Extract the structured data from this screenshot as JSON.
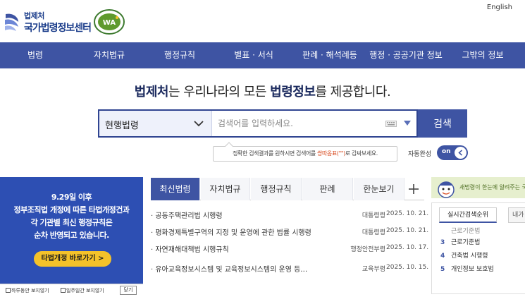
{
  "header": {
    "logo_small": "법제처",
    "logo_big": "국가법령정보센터",
    "english": "English"
  },
  "nav": {
    "items": [
      "법령",
      "자치법규",
      "행정규칙",
      "별표 · 서식",
      "판례 · 해석례등",
      "행정 · 공공기관 정보",
      "그밖의 정보"
    ]
  },
  "headline": {
    "part1": "법제처",
    "part2": "는 우리나라의 모든 ",
    "part3": "법령정보",
    "part4": "를 제공합니다."
  },
  "search": {
    "category": "현행법령",
    "placeholder": "검색어를 입력하세요.",
    "button": "검색",
    "tip_before": "정확한 검색결과를 원하시면 검색어를 ",
    "tip_highlight": "쌍따옴표(\"\")",
    "tip_after": "로 감싸보세요.",
    "autocomplete_label": "자동완성",
    "autocomplete_state": "on"
  },
  "banner": {
    "lines": [
      "9.29일 이후",
      "정부조직법 개정에 따른 타법개정건과",
      "각 기관별 최신 행정규칙은",
      "순차 반영되고 있습니다."
    ],
    "button": "타법개정 바로가기 >",
    "footer_day": "하루동안 보지않기",
    "footer_week": "일주일간 보지않기",
    "footer_close": "닫기"
  },
  "news": {
    "tabs": [
      "최신법령",
      "자치법규",
      "행정규칙",
      "판례",
      "한눈보기"
    ],
    "active_tab": 0,
    "rows": [
      {
        "title": "· 공동주택관리법 시행령",
        "agency": "대통령령",
        "date": "2025. 10. 21."
      },
      {
        "title": "· 평화경제특별구역의 지정 및 운영에 관한 법률 시행령",
        "agency": "대통령령",
        "date": "2025. 10. 21."
      },
      {
        "title": "· 자연재해대책법 시행규칙",
        "agency": "행정안전부령",
        "date": "2025. 10. 17."
      },
      {
        "title": "· 유아교육정보시스템 및 교육정보시스템의 운영 등…",
        "agency": "교육부령",
        "date": "2025. 10. 15."
      }
    ]
  },
  "right": {
    "promo": "새법령이 한눈에 알려주는 국민",
    "rank_tab": "실시간검색순위",
    "rank_tab2": "내가",
    "rank": [
      {
        "num": "",
        "label": "근로기준법"
      },
      {
        "num": "3",
        "label": "근로기준법"
      },
      {
        "num": "4",
        "label": "건축법 시행령"
      },
      {
        "num": "5",
        "label": "개인정보 보호법"
      }
    ]
  },
  "colors": {
    "primary": "#3e54a3",
    "banner": "#2d4fb3",
    "banner_button": "#f4c22a",
    "highlight": "#d84a1f"
  }
}
